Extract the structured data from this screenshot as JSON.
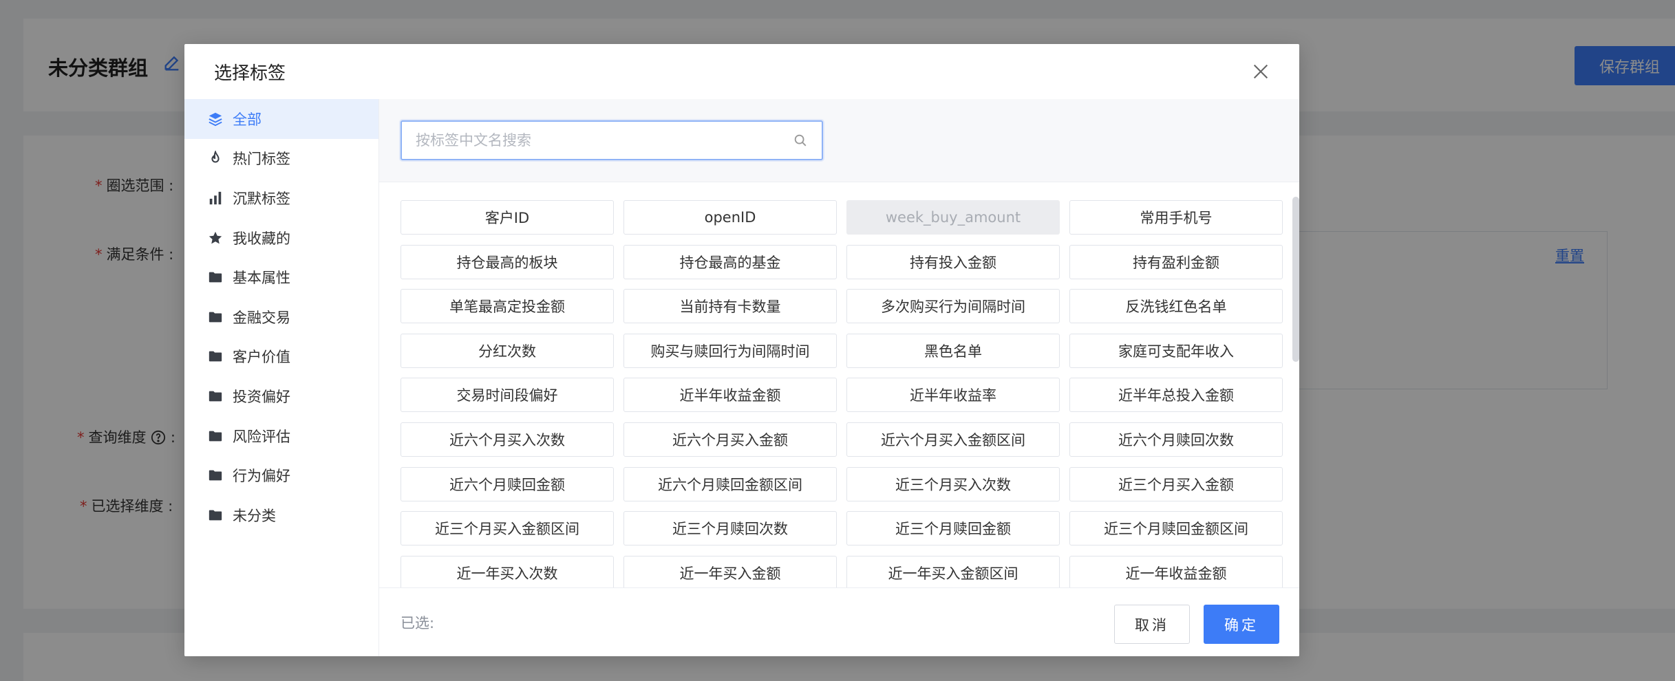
{
  "background": {
    "title": "未分类群组",
    "save_label": "保存群组",
    "labels": {
      "range": "圈选范围 :",
      "condition": "满足条件 :",
      "dimension": "查询维度",
      "dimension_colon": ":",
      "selected_dim": "已选择维度 :"
    },
    "reset_label": "重置"
  },
  "modal": {
    "title": "选择标签",
    "sidebar": {
      "items": [
        {
          "label": "全部",
          "icon": "layers-icon",
          "active": true
        },
        {
          "label": "热门标签",
          "icon": "fire-icon"
        },
        {
          "label": "沉默标签",
          "icon": "bar-chart-icon"
        },
        {
          "label": "我收藏的",
          "icon": "star-icon"
        },
        {
          "label": "基本属性",
          "icon": "folder-icon"
        },
        {
          "label": "金融交易",
          "icon": "folder-icon"
        },
        {
          "label": "客户价值",
          "icon": "folder-icon"
        },
        {
          "label": "投资偏好",
          "icon": "folder-icon"
        },
        {
          "label": "风险评估",
          "icon": "folder-icon"
        },
        {
          "label": "行为偏好",
          "icon": "folder-icon"
        },
        {
          "label": "未分类",
          "icon": "folder-icon"
        }
      ]
    },
    "search": {
      "placeholder": "按标签中文名搜索",
      "value": ""
    },
    "tags": [
      {
        "label": "客户ID"
      },
      {
        "label": "openID"
      },
      {
        "label": "week_buy_amount",
        "disabled": true
      },
      {
        "label": "常用手机号"
      },
      {
        "label": "持仓最高的板块"
      },
      {
        "label": "持仓最高的基金"
      },
      {
        "label": "持有投入金额"
      },
      {
        "label": "持有盈利金额"
      },
      {
        "label": "单笔最高定投金额"
      },
      {
        "label": "当前持有卡数量"
      },
      {
        "label": "多次购买行为间隔时间"
      },
      {
        "label": "反洗钱红色名单"
      },
      {
        "label": "分红次数"
      },
      {
        "label": "购买与赎回行为间隔时间"
      },
      {
        "label": "黑色名单"
      },
      {
        "label": "家庭可支配年收入"
      },
      {
        "label": "交易时间段偏好"
      },
      {
        "label": "近半年收益金额"
      },
      {
        "label": "近半年收益率"
      },
      {
        "label": "近半年总投入金额"
      },
      {
        "label": "近六个月买入次数"
      },
      {
        "label": "近六个月买入金额"
      },
      {
        "label": "近六个月买入金额区间"
      },
      {
        "label": "近六个月赎回次数"
      },
      {
        "label": "近六个月赎回金额"
      },
      {
        "label": "近六个月赎回金额区间"
      },
      {
        "label": "近三个月买入次数"
      },
      {
        "label": "近三个月买入金额"
      },
      {
        "label": "近三个月买入金额区间"
      },
      {
        "label": "近三个月赎回次数"
      },
      {
        "label": "近三个月赎回金额"
      },
      {
        "label": "近三个月赎回金额区间"
      },
      {
        "label": "近一年买入次数"
      },
      {
        "label": "近一年买入金额"
      },
      {
        "label": "近一年买入金额区间"
      },
      {
        "label": "近一年收益金额"
      }
    ],
    "footer": {
      "selected_label": "已选:",
      "cancel_label": "取消",
      "ok_label": "确定"
    }
  },
  "colors": {
    "accent": "#3d7cf7",
    "required": "#e53935"
  }
}
